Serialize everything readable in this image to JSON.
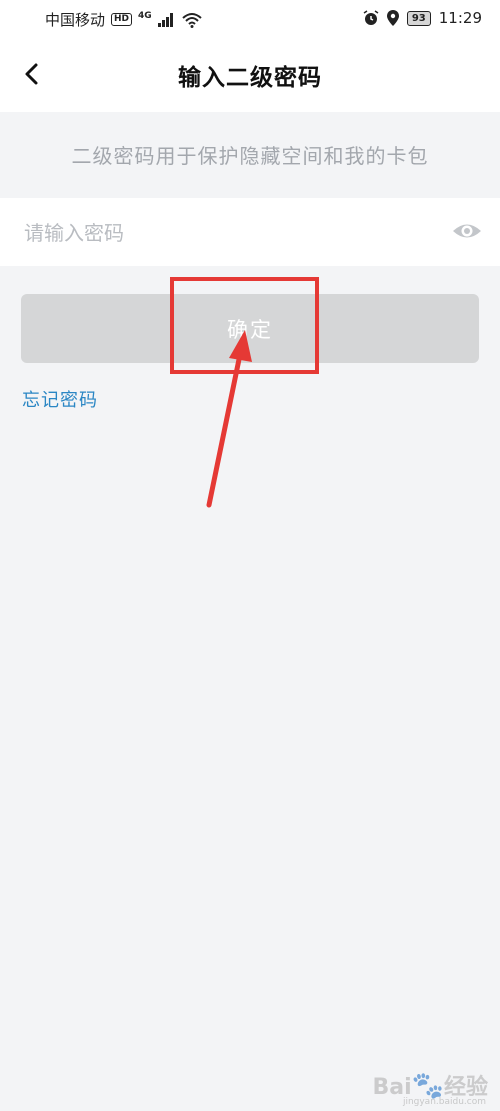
{
  "status_bar": {
    "carrier": "中国移动",
    "hd": "HD",
    "network": "4G",
    "battery": "93",
    "time": "11:29"
  },
  "header": {
    "title": "输入二级密码"
  },
  "hint": "二级密码用于保护隐藏空间和我的卡包",
  "password_field": {
    "placeholder": "请输入密码",
    "value": ""
  },
  "confirm_button": {
    "label": "确定"
  },
  "forgot_link": "忘记密码",
  "colors": {
    "accent_link": "#2a86c4",
    "annotation": "#e53935",
    "button_disabled": "#d5d6d7"
  },
  "icons": [
    "back-icon",
    "eye-icon",
    "signal-icon",
    "wifi-icon",
    "alarm-icon",
    "location-icon"
  ],
  "watermark": {
    "brand": "Bai du 经验",
    "url": "jingyan.baidu.com"
  }
}
